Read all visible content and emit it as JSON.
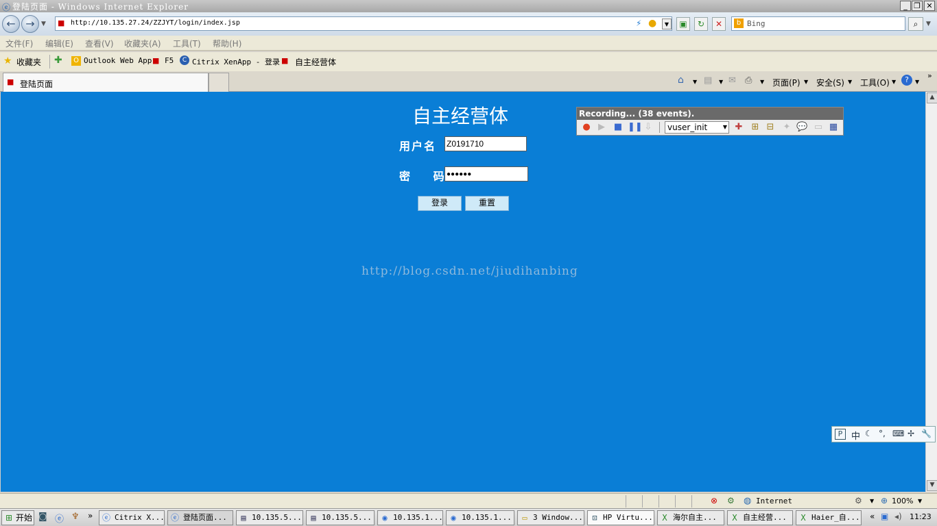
{
  "window": {
    "title": "登陆页面 - Windows Internet Explorer",
    "min": "_",
    "max": "❐",
    "close": "✕"
  },
  "nav": {
    "url": "http://10.135.27.24/ZZJYT/login/index.jsp",
    "search_placeholder": "Bing"
  },
  "menu": {
    "items": [
      {
        "label": "文件(F)"
      },
      {
        "label": "编辑(E)"
      },
      {
        "label": "查看(V)"
      },
      {
        "label": "收藏夹(A)"
      },
      {
        "label": "工具(T)"
      },
      {
        "label": "帮助(H)"
      }
    ]
  },
  "favorites": {
    "label": "收藏夹",
    "items": [
      {
        "label": "Outlook Web App"
      },
      {
        "label": "F5"
      },
      {
        "label": "Citrix XenApp - 登录"
      },
      {
        "label": "自主经营体"
      }
    ]
  },
  "tabs": {
    "active": "登陆页面"
  },
  "command_bar": {
    "page": "页面(P)",
    "safety": "安全(S)",
    "tools": "工具(O)"
  },
  "login": {
    "title": "自主经营体",
    "username_label": "用户名",
    "username_value": "Z0191710",
    "password_label": "密 码",
    "password_value": "●●●●●●",
    "login_button": "登录",
    "reset_button": "重置"
  },
  "watermark": "http://blog.csdn.net/jiudihanbing",
  "recorder": {
    "title": "Recording... (38 events).",
    "action": "vuser_init"
  },
  "ime": {
    "mode": "中"
  },
  "status": {
    "zone": "Internet",
    "zoom": "100%"
  },
  "taskbar": {
    "start": "开始",
    "clock": "11:23",
    "items": [
      {
        "label": "Citrix X..."
      },
      {
        "label": "登陆页面..."
      },
      {
        "label": "10.135.5..."
      },
      {
        "label": "10.135.5..."
      },
      {
        "label": "10.135.1..."
      },
      {
        "label": "10.135.1..."
      },
      {
        "label": "3 Window..."
      },
      {
        "label": "HP Virtu..."
      },
      {
        "label": "海尔自主..."
      },
      {
        "label": "自主经营..."
      },
      {
        "label": "Haier_自..."
      }
    ]
  }
}
